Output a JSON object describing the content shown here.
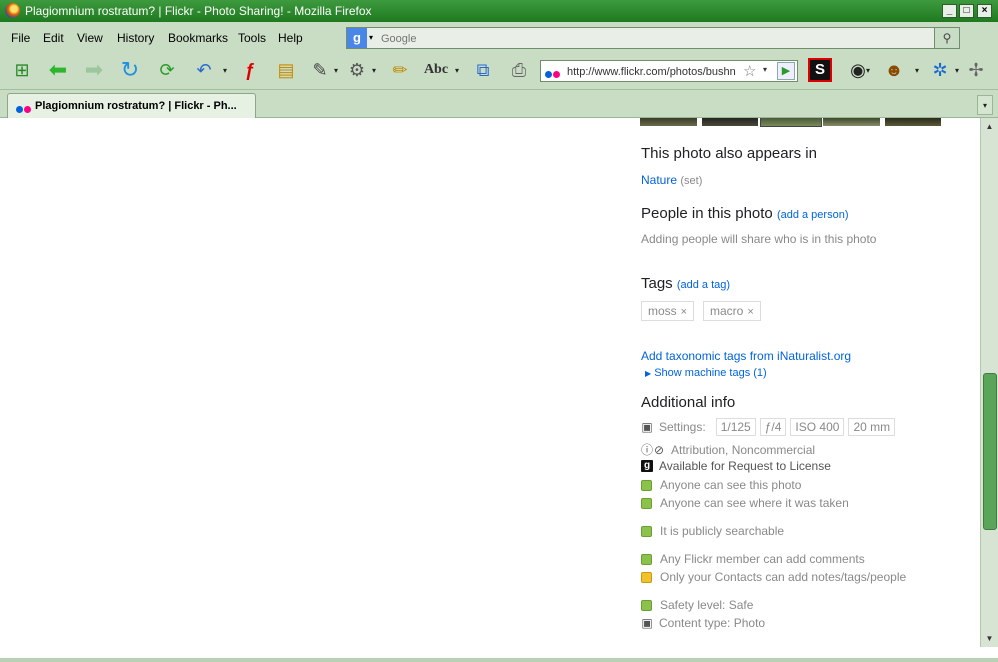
{
  "window": {
    "title": "Plagiomnium rostratum? | Flickr - Photo Sharing! - Mozilla Firefox"
  },
  "menu": {
    "file": "File",
    "edit": "Edit",
    "view": "View",
    "history": "History",
    "bookmarks": "Bookmarks",
    "tools": "Tools",
    "help": "Help"
  },
  "search": {
    "engine_icon": "google-g-icon",
    "placeholder": "Google"
  },
  "navbar": {
    "url": "http://www.flickr.com/photos/bushn"
  },
  "tab": {
    "label": "Plagiomnium rostratum? | Flickr - Ph..."
  },
  "page": {
    "also_appears": {
      "heading": "This photo also appears in",
      "set_name": "Nature",
      "set_type": "(set)"
    },
    "people": {
      "heading": "People in this photo",
      "add_link": "(add a person)",
      "hint": "Adding people will share who is in this photo"
    },
    "tags": {
      "heading": "Tags",
      "add_link": "(add a tag)",
      "items": [
        "moss",
        "macro"
      ],
      "remove_glyph": "×"
    },
    "taxonomic_link": "Add taxonomic tags from iNaturalist.org",
    "machine_tags_link": "Show machine tags (1)",
    "additional_info": {
      "heading": "Additional info",
      "settings_label": "Settings:",
      "settings": [
        "1/125",
        "ƒ/4",
        "ISO 400",
        "20 mm"
      ],
      "license": "Attribution, Noncommercial",
      "getty": "Available for Request to License",
      "privacy": [
        "Anyone can see this photo",
        "Anyone can see where it was taken",
        "It is publicly searchable",
        "Any Flickr member can add comments",
        "Only your Contacts can add notes/tags/people",
        "Safety level: Safe"
      ],
      "content_type": "Content type: Photo"
    }
  },
  "colors": {
    "link": "#0063dc",
    "muted": "#898989",
    "chrome_green": "#c8ddc4",
    "titlebar_green": "#2e8b2e",
    "status_green": "#8bc34a",
    "status_yellow": "#f2c12e"
  }
}
